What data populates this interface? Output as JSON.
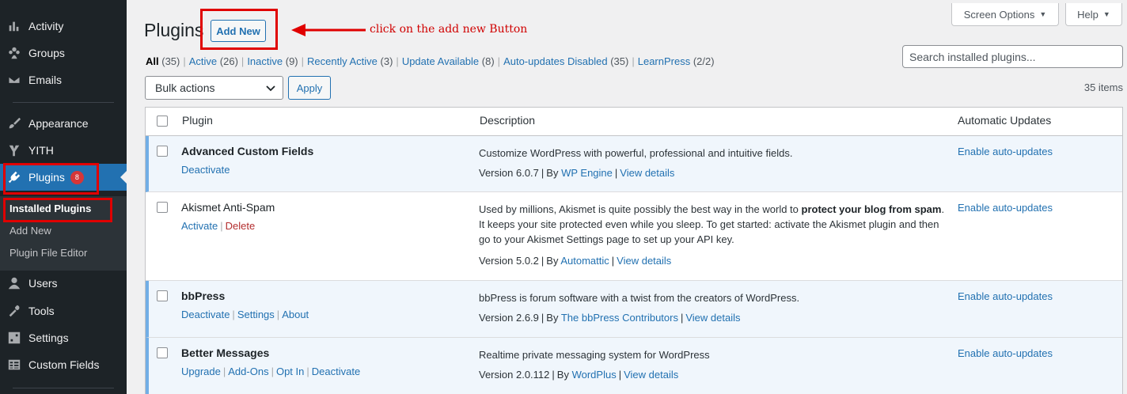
{
  "sidebar": {
    "items": [
      {
        "label": "Activity",
        "icon": "activity-icon"
      },
      {
        "label": "Groups",
        "icon": "groups-icon"
      },
      {
        "label": "Emails",
        "icon": "email-icon"
      },
      {
        "label": "Appearance",
        "icon": "appearance-brush-icon"
      },
      {
        "label": "YITH",
        "icon": "yith-logo-icon"
      },
      {
        "label": "Plugins",
        "icon": "plugins-icon",
        "badge": "8"
      },
      {
        "label": "Users",
        "icon": "users-icon"
      },
      {
        "label": "Tools",
        "icon": "tools-icon"
      },
      {
        "label": "Settings",
        "icon": "settings-icon"
      },
      {
        "label": "Custom Fields",
        "icon": "custom-fields-icon"
      }
    ],
    "plugins_submenu": [
      "Installed Plugins",
      "Add New",
      "Plugin File Editor"
    ]
  },
  "header": {
    "title": "Plugins",
    "add_new_label": "Add New",
    "screen_options_label": "Screen Options",
    "help_label": "Help"
  },
  "annotation": {
    "text": "click on the add new Button",
    "color": "#e00000"
  },
  "filters": [
    {
      "label": "All",
      "count": "(35)"
    },
    {
      "label": "Active",
      "count": "(26)"
    },
    {
      "label": "Inactive",
      "count": "(9)"
    },
    {
      "label": "Recently Active",
      "count": "(3)"
    },
    {
      "label": "Update Available",
      "count": "(8)"
    },
    {
      "label": "Auto-updates Disabled",
      "count": "(35)"
    },
    {
      "label": "LearnPress",
      "count": "(2/2)"
    }
  ],
  "search": {
    "placeholder": "Search installed plugins..."
  },
  "bulk": {
    "selected": "Bulk actions",
    "apply_label": "Apply"
  },
  "items_count": "35 items",
  "table": {
    "columns": [
      "Plugin",
      "Description",
      "Automatic Updates"
    ],
    "rows": [
      {
        "name": "Advanced Custom Fields",
        "status": "active",
        "actions": [
          "Deactivate"
        ],
        "description": "Customize WordPress with powerful, professional and intuitive fields.",
        "version": "Version 6.0.7",
        "by_prefix": "By",
        "author": "WP Engine",
        "details": "View details",
        "auto_updates": "Enable auto-updates"
      },
      {
        "name": "Akismet Anti-Spam",
        "status": "inactive",
        "actions": [
          "Activate",
          "Delete"
        ],
        "description_pre": "Used by millions, Akismet is quite possibly the best way in the world to ",
        "description_bold": "protect your blog from spam",
        "description_post": ". It keeps your site protected even while you sleep. To get started: activate the Akismet plugin and then go to your Akismet Settings page to set up your API key.",
        "version": "Version 5.0.2",
        "by_prefix": "By",
        "author": "Automattic",
        "details": "View details",
        "auto_updates": "Enable auto-updates"
      },
      {
        "name": "bbPress",
        "status": "active",
        "actions": [
          "Deactivate",
          "Settings",
          "About"
        ],
        "description": "bbPress is forum software with a twist from the creators of WordPress.",
        "version": "Version 2.6.9",
        "by_prefix": "By",
        "author": "The bbPress Contributors",
        "details": "View details",
        "auto_updates": "Enable auto-updates"
      },
      {
        "name": "Better Messages",
        "status": "active",
        "actions": [
          "Upgrade",
          "Add-Ons",
          "Opt In",
          "Deactivate"
        ],
        "description": "Realtime private messaging system for WordPress",
        "version": "Version 2.0.112",
        "by_prefix": "By",
        "author": "WordPlus",
        "details": "View details",
        "auto_updates": "Enable auto-updates"
      }
    ]
  }
}
